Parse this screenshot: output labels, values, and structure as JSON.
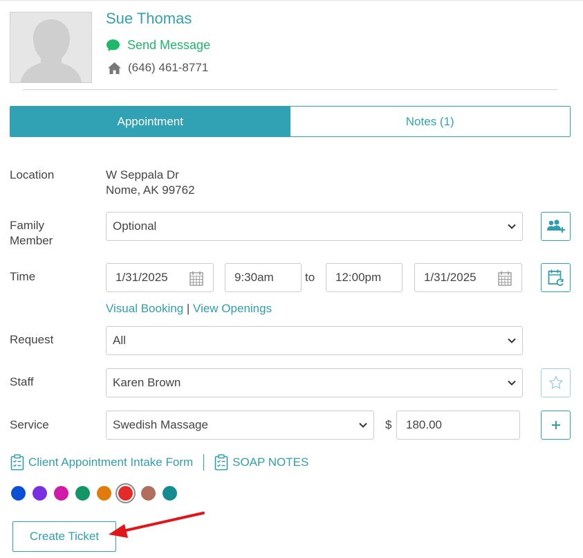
{
  "client": {
    "name": "Sue Thomas",
    "send_message": "Send Message",
    "phone": "(646) 461-8771"
  },
  "tabs": [
    {
      "label": "Appointment",
      "active": true
    },
    {
      "label": "Notes (1)",
      "active": false
    }
  ],
  "location": {
    "label": "Location",
    "line1": "W Seppala Dr",
    "line2": "Nome, AK 99762"
  },
  "family": {
    "label_line1": "Family",
    "label_line2": "Member",
    "value": "Optional",
    "button_icon": "add-family-icon"
  },
  "time": {
    "label": "Time",
    "start_date": "1/31/2025",
    "start_time": "9:30am",
    "to_label": "to",
    "end_time": "12:00pm",
    "end_date": "1/31/2025",
    "button_icon": "calendar-refresh-icon"
  },
  "booking_links": {
    "visual_booking": "Visual Booking",
    "separator": "|",
    "view_openings": "View Openings"
  },
  "request": {
    "label": "Request",
    "value": "All"
  },
  "staff": {
    "label": "Staff",
    "value": "Karen Brown",
    "button_icon": "star-outline-icon"
  },
  "service": {
    "label": "Service",
    "value": "Swedish Massage",
    "currency": "$",
    "price": "180.00",
    "button_icon": "plus-icon"
  },
  "forms": [
    {
      "label": "Client Appointment Intake Form",
      "icon": "clipboard-check-icon"
    },
    {
      "label": "SOAP NOTES",
      "icon": "clipboard-check-icon"
    }
  ],
  "color_swatches": [
    "#0b4fd6",
    "#7a2fe0",
    "#d11ba8",
    "#129666",
    "#e07b0c",
    "#e52a2a",
    "#b06e5e",
    "#138b91"
  ],
  "selected_color": "#e52a2a",
  "create_ticket": "Create Ticket",
  "theme": {
    "accent": "#31a2b3",
    "message_green": "#1fb86a",
    "annotation_arrow": "#e0161b"
  }
}
